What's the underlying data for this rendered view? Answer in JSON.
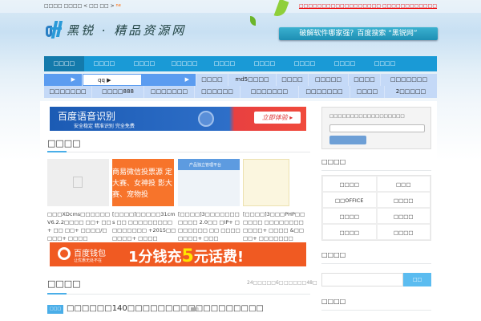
{
  "topbar": {
    "left": "□□□□ □□□□ < □□ □□ >",
    "new_badge": "ne",
    "right": "□□□□□□□□□□□□□□□□□□ □□□□□□□□□□□□"
  },
  "logo": {
    "text": "黑锐 · 精品资源网"
  },
  "slogan": "破解软件哪家强？百度搜索 “黑锐网”",
  "nav": [
    "□□□□",
    "□□□□",
    "□□□□",
    "□□□□□",
    "□□□□",
    "□□□□",
    "□□□□",
    "□□□□",
    "□□□□"
  ],
  "subrow1": [
    "▶",
    "qq   ▶",
    "▶",
    "□□□□",
    "md5□□□□",
    "□□□□",
    "□□□□□",
    "□□□□",
    "□□□□□□□"
  ],
  "subrow2": [
    "□□□□□□□",
    "□□□□888",
    "□□□□□□□",
    "□□□□□□",
    "□□□□□□□",
    "□□□□□□□",
    "□□□□",
    "2□□□□□"
  ],
  "ad1": {
    "title": "百度语音识别",
    "sub": "安全稳定    精准识别    完全免费",
    "button": "立即体验 ▸"
  },
  "section1": {
    "title": "□□□□",
    "items": [
      {
        "thumb_text": "",
        "caption": "□□□XDcms□□□□□□ V6.2.2□□□□ □□+ □□+ □□ □□+ □□□□/□□□□+ □□□□"
      },
      {
        "thumb_text": "商易微信投票源 定大赛、女神投 影大赛、宠物投",
        "caption": "[□□□□]□□□□□31cms □□ □□□□□□□□□ □□□□□□□ +2015□□□□□□+ □□□□"
      },
      {
        "thumb_text": "产品独立管理平台",
        "caption": "[□□□□]3□□□□□□□□□□□ 2.0□□ □IP+ □□□□□□□ □□ □□□□□□□□+ □□□"
      },
      {
        "thumb_text": "",
        "caption": "[□□□□]3□□□PHP□□□□□□ □□□□□□□□□□□□+ □□□□ &□□□□+ □□□□□□□"
      }
    ]
  },
  "ad2": {
    "brand": "百度钱包",
    "brand_sub": "让优惠无处不在",
    "text": "1分钱充",
    "five": "5",
    "tail": "元话费!"
  },
  "section2": {
    "title": "□□□□",
    "meta1": "24□□□□□6□",
    "meta2": "□□□□□48□",
    "item": {
      "tag": "□□□",
      "title": "□□□□□□140□□□□□□□□□□□□□□□□□□",
      "img_count": "1"
    }
  },
  "sidebar": {
    "login_label": "□□□□□□□□□□□□□□□□□□",
    "cat_title": "□□□□",
    "cats": [
      "□□□□",
      "□□□",
      "□□OFFICE",
      "□□□□",
      "□□□□",
      "□□□□",
      "□□□□",
      "□□□□"
    ],
    "search_title": "□□□□",
    "search_button": "□□",
    "search_placeholder": "",
    "last_title": "□□□□"
  }
}
